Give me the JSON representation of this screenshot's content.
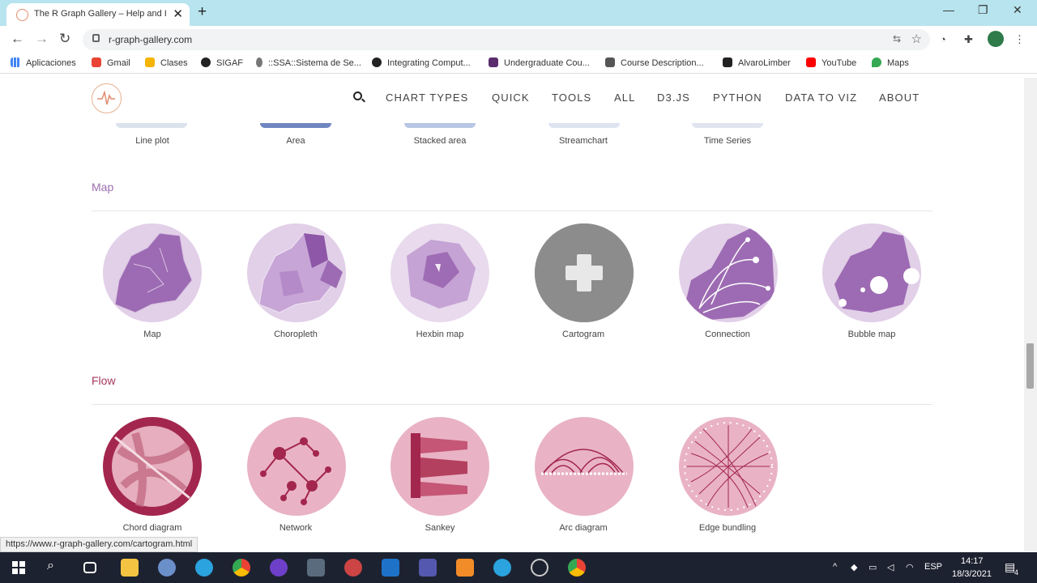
{
  "browser": {
    "tab_title": "The R Graph Gallery – Help and Inspiration for R Charts",
    "close_glyph": "✕",
    "new_tab_glyph": "+",
    "url": "r-graph-gallery.com",
    "bookmarks": [
      "Aplicaciones",
      "Gmail",
      "Clases",
      "SIGAF",
      "::SSA::Sistema de Se...",
      "Integrating Comput...",
      "Undergraduate Cou...",
      "Course Description...",
      "AlvaroLimber",
      "YouTube",
      "Maps"
    ]
  },
  "site": {
    "nav": [
      "CHART TYPES",
      "QUICK",
      "TOOLS",
      "ALL",
      "D3.JS",
      "PYTHON",
      "DATA TO VIZ",
      "ABOUT"
    ],
    "previous_row": [
      "Line plot",
      "Area",
      "Stacked area",
      "Streamchart",
      "Time Series"
    ],
    "sections": [
      {
        "title": "Map",
        "color": "#9b6fb0",
        "items": [
          "Map",
          "Choropleth",
          "Hexbin map",
          "Cartogram",
          "Connection",
          "Bubble map"
        ]
      },
      {
        "title": "Flow",
        "color": "#a3385b",
        "items": [
          "Chord diagram",
          "Network",
          "Sankey",
          "Arc diagram",
          "Edge bundling"
        ]
      }
    ]
  },
  "status_url": "https://www.r-graph-gallery.com/cartogram.html",
  "taskbar": {
    "lang": "ESP",
    "time": "14:17",
    "date": "18/3/2021",
    "notif_count": "4"
  }
}
